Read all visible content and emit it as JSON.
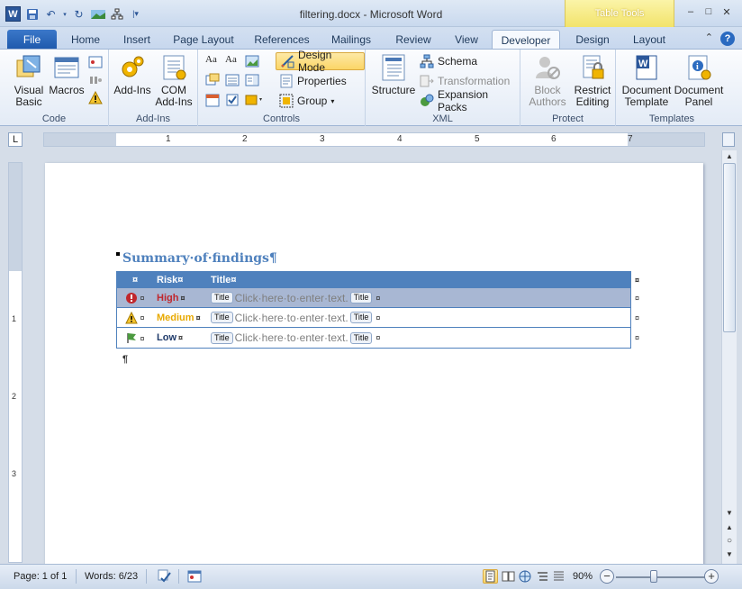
{
  "window": {
    "title": "filtering.docx - Microsoft Word",
    "contextual_header": "Table Tools",
    "controls": [
      "–",
      "□",
      "✕"
    ]
  },
  "quick_access": {
    "app_icon": "W",
    "save_icon": "save-icon",
    "undo_icon": "undo-icon",
    "redo_icon": "redo-icon"
  },
  "tabs": [
    "File",
    "Home",
    "Insert",
    "Page Layout",
    "References",
    "Mailings",
    "Review",
    "View",
    "Developer",
    "Design",
    "Layout"
  ],
  "ribbon": {
    "code": {
      "label": "Code",
      "visual_basic": "Visual Basic",
      "macros": "Macros"
    },
    "addins": {
      "label": "Add-Ins",
      "add_ins": "Add-Ins",
      "com_add_ins": "COM Add-Ins"
    },
    "controls": {
      "label": "Controls",
      "design_mode": "Design Mode",
      "properties": "Properties",
      "group": "Group"
    },
    "xml": {
      "label": "XML",
      "structure": "Structure",
      "schema": "Schema",
      "transformation": "Transformation",
      "expansion_packs": "Expansion Packs"
    },
    "protect": {
      "label": "Protect",
      "block_authors": "Block Authors",
      "restrict_editing": "Restrict Editing"
    },
    "templates": {
      "label": "Templates",
      "document_template": "Document Template",
      "document_panel": "Document Panel"
    }
  },
  "ruler": {
    "numbers": [
      "1",
      "2",
      "3",
      "4",
      "5",
      "6",
      "7"
    ],
    "vnumbers": [
      "1",
      "2",
      "3"
    ]
  },
  "document": {
    "heading": "Summary·of·findings¶",
    "table": {
      "headers": [
        "¤",
        "Risk¤",
        "Title¤"
      ],
      "rows": [
        {
          "risk": "High",
          "level": "high",
          "icon": "error-icon",
          "tag": "Title",
          "placeholder": "Click·here·to·enter·text."
        },
        {
          "risk": "Medium",
          "level": "medium",
          "icon": "warning-icon",
          "tag": "Title",
          "placeholder": "Click·here·to·enter·text."
        },
        {
          "risk": "Low",
          "level": "low",
          "icon": "flag-icon",
          "tag": "Title",
          "placeholder": "Click·here·to·enter·text."
        }
      ],
      "cell_mark": "¤"
    },
    "trailing_paragraph": "¶"
  },
  "status_bar": {
    "page": "Page: 1 of 1",
    "words": "Words: 6/23",
    "zoom": "90%",
    "zoom_level": 0.9
  }
}
